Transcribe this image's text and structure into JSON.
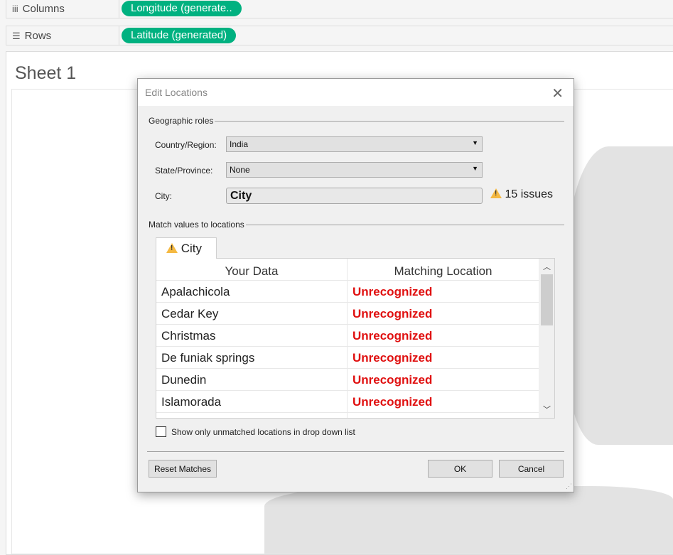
{
  "shelves": {
    "columns": {
      "icon": "columns-icon",
      "label": "Columns",
      "pill": "Longitude (generate.."
    },
    "rows": {
      "icon": "rows-icon",
      "label": "Rows",
      "pill": "Latitude (generated)"
    }
  },
  "sheet": {
    "title": "Sheet 1"
  },
  "dialog": {
    "title": "Edit Locations",
    "geo_group": "Geographic roles",
    "country_label": "Country/Region:",
    "country_value": "India",
    "state_label": "State/Province:",
    "state_value": "None",
    "city_label": "City:",
    "city_value": "City",
    "issues": "15 issues",
    "match_group": "Match values to locations",
    "tab": "City",
    "columns": [
      "Your Data",
      "Matching Location"
    ],
    "rows": [
      {
        "data": "Apalachicola",
        "match": "Unrecognized"
      },
      {
        "data": "Cedar Key",
        "match": "Unrecognized"
      },
      {
        "data": "Christmas",
        "match": "Unrecognized"
      },
      {
        "data": "De funiak springs",
        "match": "Unrecognized"
      },
      {
        "data": "Dunedin",
        "match": "Unrecognized"
      },
      {
        "data": "Islamorada",
        "match": "Unrecognized"
      }
    ],
    "checkbox_label": "Show only unmatched locations in drop down list",
    "checkbox_checked": false,
    "reset": "Reset Matches",
    "ok": "OK",
    "cancel": "Cancel"
  },
  "colors": {
    "pill": "#00b180",
    "unrecognized": "#e01010",
    "warning": "#f5b942"
  }
}
